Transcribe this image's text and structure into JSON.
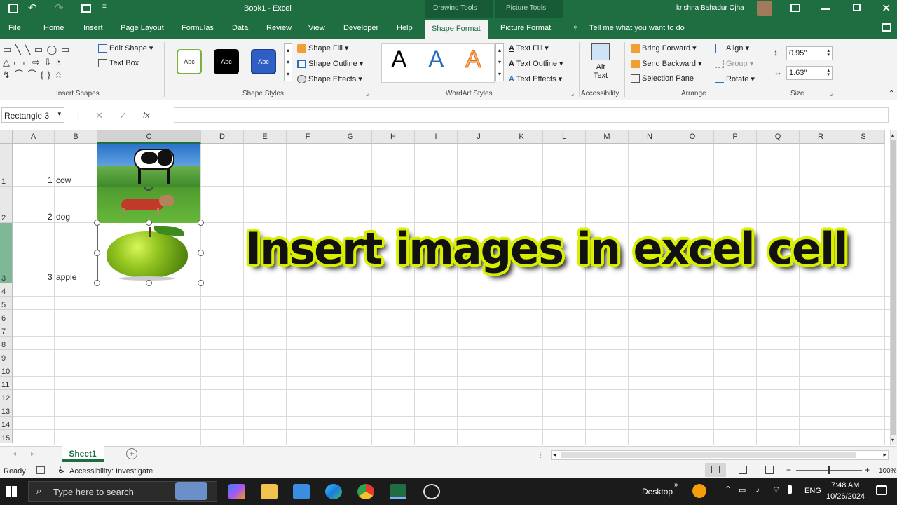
{
  "window": {
    "title": "Book1 - Excel",
    "context_tab_drawing": "Drawing Tools",
    "context_tab_picture": "Picture Tools",
    "user": "krishna Bahadur Ojha"
  },
  "tabs": [
    "File",
    "Home",
    "Insert",
    "Page Layout",
    "Formulas",
    "Data",
    "Review",
    "View",
    "Developer",
    "Help",
    "Shape Format",
    "Picture Format"
  ],
  "tell_me": "Tell me what you want to do",
  "ribbon": {
    "insert_shapes": {
      "edit_shape": "Edit Shape",
      "text_box": "Text Box",
      "label": "Insert Shapes"
    },
    "shape_styles": {
      "sample": "Abc",
      "shape_fill": "Shape Fill",
      "shape_outline": "Shape Outline",
      "shape_effects": "Shape Effects",
      "label": "Shape Styles"
    },
    "wordart": {
      "letter": "A",
      "text_fill": "Text Fill",
      "text_outline": "Text Outline",
      "text_effects": "Text Effects",
      "label": "WordArt Styles"
    },
    "accessibility": {
      "alt1": "Alt",
      "alt2": "Text",
      "label": "Accessibility"
    },
    "arrange": {
      "bring_forward": "Bring Forward",
      "send_backward": "Send Backward",
      "selection_pane": "Selection Pane",
      "align": "Align",
      "group": "Group",
      "rotate": "Rotate",
      "label": "Arrange"
    },
    "size": {
      "height": "0.95\"",
      "width": "1.63\"",
      "label": "Size"
    }
  },
  "formula_bar": {
    "name_box": "Rectangle 3",
    "fx": "fx"
  },
  "columns": [
    "A",
    "B",
    "C",
    "D",
    "E",
    "F",
    "G",
    "H",
    "I",
    "J",
    "K",
    "L",
    "M",
    "N",
    "O",
    "P",
    "Q",
    "R",
    "S"
  ],
  "rows": [
    "1",
    "2",
    "3",
    "4",
    "5",
    "6",
    "7",
    "8",
    "9",
    "10",
    "11",
    "12",
    "13",
    "14",
    "15"
  ],
  "cells": [
    {
      "num": "1",
      "name": "cow"
    },
    {
      "num": "2",
      "name": "dog"
    },
    {
      "num": "3",
      "name": "apple"
    }
  ],
  "overlay_text": "Insert images in excel cell",
  "sheet_tab": "Sheet1",
  "status": {
    "ready": "Ready",
    "accessibility": "Accessibility: Investigate",
    "zoom": "100%"
  },
  "taskbar": {
    "search": "Type here to search",
    "desktop": "Desktop",
    "lang": "ENG",
    "time": "7:48 AM",
    "date": "10/26/2024"
  }
}
